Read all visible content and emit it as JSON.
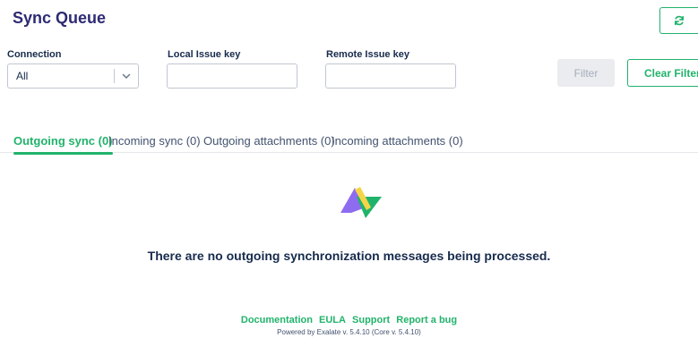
{
  "header": {
    "title": "Sync Queue",
    "refresh_icon": "refresh-icon"
  },
  "filters": {
    "connection_label": "Connection",
    "connection_value": "All",
    "local_key_label": "Local Issue key",
    "local_key_value": "",
    "remote_key_label": "Remote Issue key",
    "remote_key_value": "",
    "filter_button": "Filter",
    "clear_filter_button": "Clear Filter"
  },
  "tabs": [
    {
      "label": "Outgoing sync (0)",
      "active": true
    },
    {
      "label": "Incoming sync (0)",
      "active": false
    },
    {
      "label": "Outgoing attachments (0)",
      "active": false
    },
    {
      "label": "Incoming attachments (0)",
      "active": false
    }
  ],
  "empty_state": {
    "icon": "exalate-logo",
    "message": "There are no outgoing synchronization messages being processed."
  },
  "footer": {
    "links": [
      "Documentation",
      "EULA",
      "Support",
      "Report a bug"
    ],
    "powered_by": "Powered by Exalate v. 5.4.10 (Core v. 5.4.10)"
  },
  "colors": {
    "accent": "#21b36b",
    "title": "#2d2a73",
    "logo_purple": "#8e6cf0",
    "logo_yellow": "#f5d547"
  }
}
